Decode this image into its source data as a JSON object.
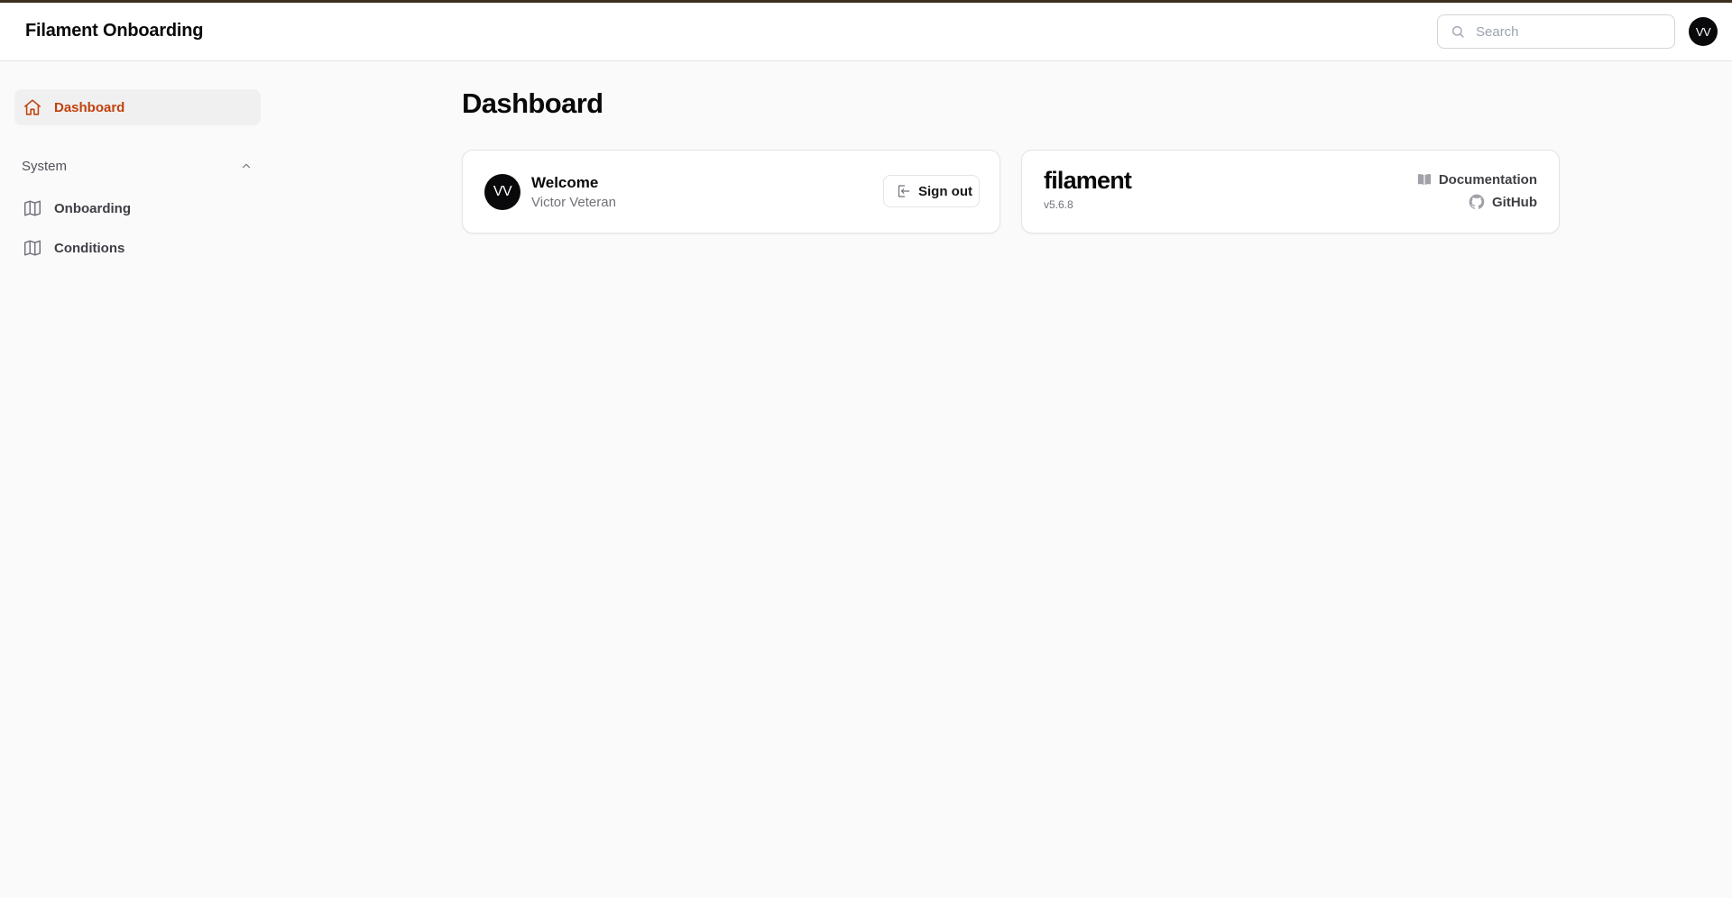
{
  "app": {
    "title": "Filament Onboarding"
  },
  "header": {
    "search_placeholder": "Search",
    "user_initials": "VV"
  },
  "sidebar": {
    "items": [
      {
        "label": "Dashboard",
        "icon": "home-icon",
        "active": true
      }
    ],
    "groups": [
      {
        "label": "System",
        "expanded": true,
        "items": [
          {
            "label": "Onboarding",
            "icon": "map-icon"
          },
          {
            "label": "Conditions",
            "icon": "map-icon"
          }
        ]
      }
    ]
  },
  "main": {
    "title": "Dashboard",
    "welcome_card": {
      "initials": "VV",
      "title": "Welcome",
      "name": "Victor Veteran",
      "signout_label": "Sign out"
    },
    "info_card": {
      "logo_text": "filament",
      "version": "v5.6.8",
      "docs_label": "Documentation",
      "github_label": "GitHub"
    }
  },
  "colors": {
    "accent": "#c2410c",
    "top_accent": "#3b2f1e",
    "avatar_bg": "#09090b"
  }
}
